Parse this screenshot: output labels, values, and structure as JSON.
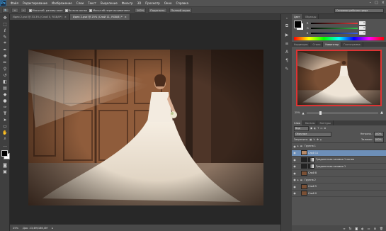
{
  "app": {
    "logo": "Ps"
  },
  "menubar": [
    "Файл",
    "Редактирование",
    "Изображение",
    "Слои",
    "Текст",
    "Выделение",
    "Фильтр",
    "3D",
    "Просмотр",
    "Окно",
    "Справка"
  ],
  "window_controls": [
    "–",
    "□",
    "×"
  ],
  "options": {
    "fit_label": "Масштаб. размер окон",
    "all_windows_label": "Во всех окнах",
    "scrubby_label": "Масштаб перетаскиванием",
    "zoom_pct": "100%",
    "fit_screen": "Подогнать",
    "fill_screen": "Полный экран",
    "workspace": "Основная рабочая среда"
  },
  "tabs": [
    {
      "label": "Идея 2.psd @ 33.3% (Слой 0, RGB/8*)",
      "close": "×"
    },
    {
      "label": "Идея 2.psd @ 25% (Слой 11, RGB/8) *",
      "close": "×"
    }
  ],
  "status": {
    "zoom": "25%",
    "doc": "Док: 23,4M/186,4M"
  },
  "color_panel": {
    "tabs": [
      "Цвет",
      "Образцы"
    ],
    "rows": [
      {
        "label": "R",
        "value": "0",
        "color": "#e23b3b"
      },
      {
        "label": "G",
        "value": "0",
        "color": "#35c14a"
      },
      {
        "label": "B",
        "value": "0",
        "color": "#3b64e8"
      }
    ]
  },
  "adjust_panel": {
    "tabs": [
      "Коррекция",
      "Стили",
      "Навигатор",
      "Гистограмма"
    ]
  },
  "navigator": {
    "zoom": "25%"
  },
  "layers_panel": {
    "tabs": [
      "Слои",
      "Каналы",
      "Контуры"
    ],
    "kind": "Вид",
    "blend": "Обычные",
    "opacity_label": "Непрозр.:",
    "opacity": "100%",
    "lock_label": "Закрепить:",
    "fill_label": "Заливка:",
    "fill": "100%",
    "layers": [
      {
        "name": "Группа 1",
        "type": "group",
        "selected": false
      },
      {
        "name": "Слой 11",
        "type": "layer",
        "selected": true
      },
      {
        "name": "Градиентная заливка 1 копия",
        "type": "fill",
        "selected": false
      },
      {
        "name": "Градиентная заливка 1",
        "type": "fill",
        "selected": false
      },
      {
        "name": "Слой 8",
        "type": "layer",
        "selected": false
      },
      {
        "name": "Группа 2",
        "type": "group",
        "selected": false
      },
      {
        "name": "Слой 5",
        "type": "layer",
        "selected": false
      },
      {
        "name": "Слой 0",
        "type": "layer",
        "selected": false
      }
    ]
  }
}
